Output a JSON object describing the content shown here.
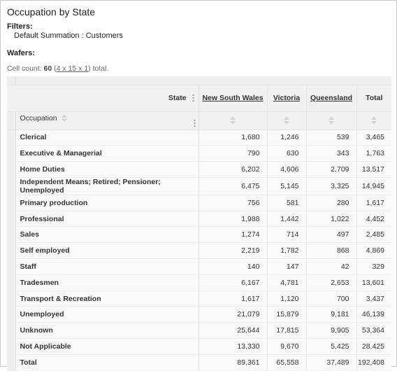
{
  "title": "Occupation by State",
  "filters": {
    "label": "Filters:",
    "items": [
      "Default Summation : Customers"
    ]
  },
  "wafers": {
    "label": "Wafers:"
  },
  "cell_count": {
    "prefix": "Cell count:",
    "count": "60",
    "dims": "4 x 15 x 1",
    "suffix": "total."
  },
  "table": {
    "column_dimension": "State",
    "row_dimension": "Occupation",
    "columns": [
      "New South Wales",
      "Victoria",
      "Queensland",
      "Total"
    ],
    "rows": [
      {
        "label": "Clerical",
        "values": [
          "1,680",
          "1,246",
          "539",
          "3,465"
        ]
      },
      {
        "label": "Executive & Managerial",
        "values": [
          "790",
          "630",
          "343",
          "1,763"
        ]
      },
      {
        "label": "Home Duties",
        "values": [
          "6,202",
          "4,606",
          "2,709",
          "13,517"
        ]
      },
      {
        "label": "Independent Means; Retired; Pensioner; Unemployed",
        "values": [
          "6,475",
          "5,145",
          "3,325",
          "14,945"
        ]
      },
      {
        "label": "Primary production",
        "values": [
          "756",
          "581",
          "280",
          "1,617"
        ]
      },
      {
        "label": "Professional",
        "values": [
          "1,988",
          "1,442",
          "1,022",
          "4,452"
        ]
      },
      {
        "label": "Sales",
        "values": [
          "1,274",
          "714",
          "497",
          "2,485"
        ]
      },
      {
        "label": "Self employed",
        "values": [
          "2,219",
          "1,782",
          "868",
          "4,869"
        ]
      },
      {
        "label": "Staff",
        "values": [
          "140",
          "147",
          "42",
          "329"
        ]
      },
      {
        "label": "Tradesmen",
        "values": [
          "6,167",
          "4,781",
          "2,653",
          "13,601"
        ]
      },
      {
        "label": "Transport & Recreation",
        "values": [
          "1,617",
          "1,120",
          "700",
          "3,437"
        ]
      },
      {
        "label": "Unemployed",
        "values": [
          "21,079",
          "15,879",
          "9,181",
          "46,139"
        ]
      },
      {
        "label": "Unknown",
        "values": [
          "25,644",
          "17,815",
          "9,905",
          "53,364"
        ]
      },
      {
        "label": "Not Applicable",
        "values": [
          "13,330",
          "9,670",
          "5,425",
          "28,425"
        ]
      },
      {
        "label": "Total",
        "values": [
          "89,361",
          "65,558",
          "37,489",
          "192,408"
        ]
      }
    ]
  }
}
